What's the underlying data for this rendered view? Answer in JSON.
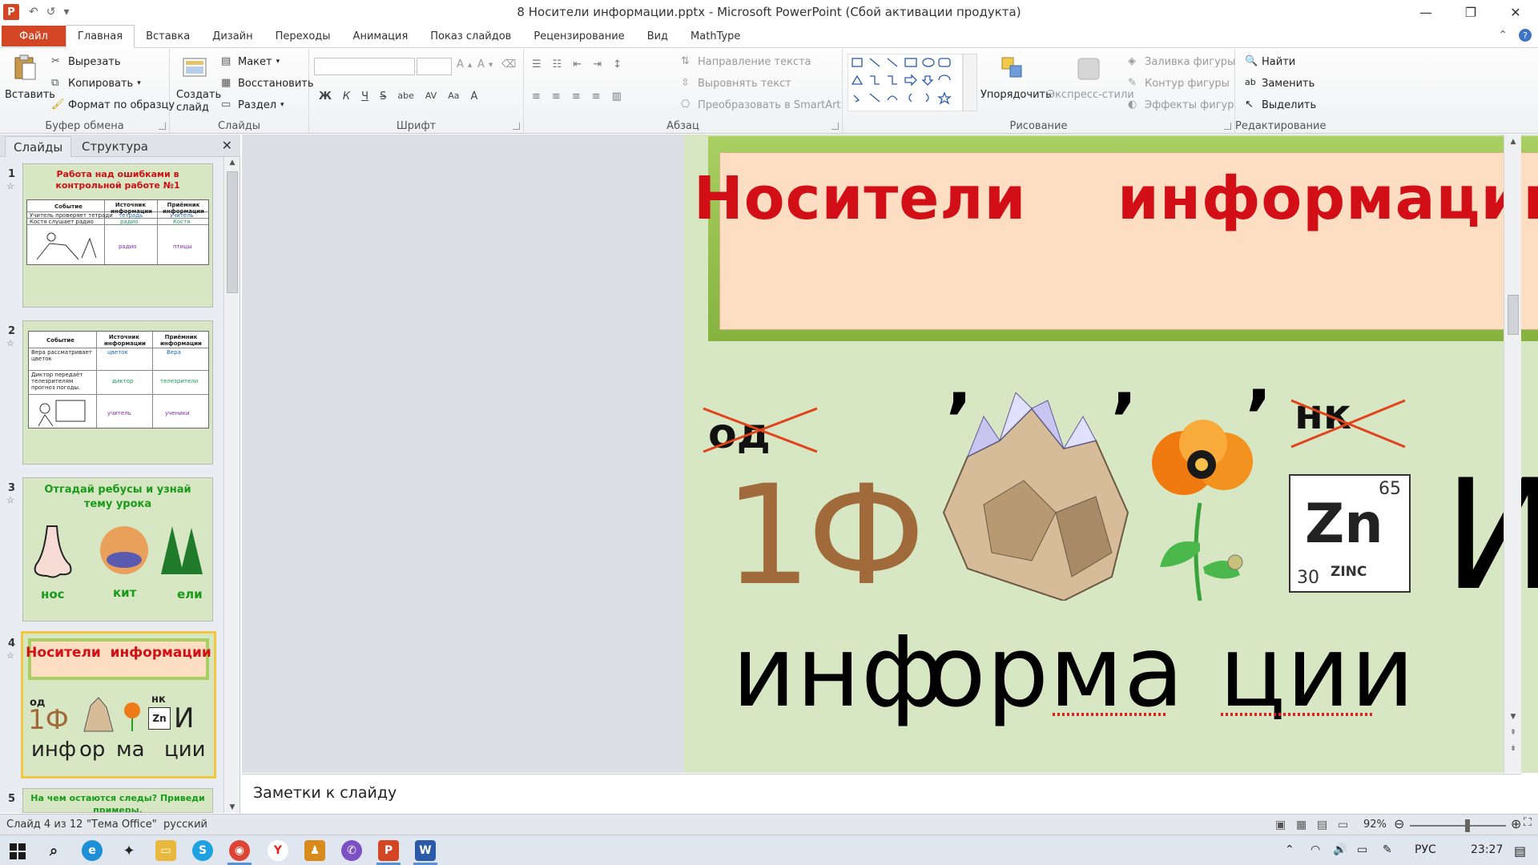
{
  "window": {
    "title": "8 Носители информации.pptx - Microsoft PowerPoint (Сбой активации продукта)",
    "qat_icons": [
      "save-icon",
      "undo-icon",
      "redo-icon",
      "customize-icon"
    ]
  },
  "tabs": [
    "Файл",
    "Главная",
    "Вставка",
    "Дизайн",
    "Переходы",
    "Анимация",
    "Показ слайдов",
    "Рецензирование",
    "Вид",
    "MathType"
  ],
  "active_tab": "Главная",
  "ribbon": {
    "clipboard": {
      "label": "Буфер обмена",
      "paste": "Вставить",
      "cut": "Вырезать",
      "copy": "Копировать",
      "format_painter": "Формат по образцу"
    },
    "slides": {
      "label": "Слайды",
      "new_slide": "Создать слайд",
      "layout": "Макет",
      "reset": "Восстановить",
      "section": "Раздел"
    },
    "font": {
      "label": "Шрифт",
      "name": "",
      "size": "",
      "bold": "Ж",
      "italic": "К",
      "underline": "Ч",
      "strike": "S",
      "shadow": "abe",
      "spacing": "AV",
      "case": "Aa",
      "color": "A"
    },
    "paragraph": {
      "label": "Абзац",
      "text_direction": "Направление текста",
      "align_text": "Выровнять текст",
      "smartart": "Преобразовать в SmartArt"
    },
    "drawing": {
      "label": "Рисование",
      "arrange": "Упорядочить",
      "quick_styles": "Экспресс-стили",
      "shape_fill": "Заливка фигуры",
      "shape_outline": "Контур фигуры",
      "shape_effects": "Эффекты фигур"
    },
    "editing": {
      "label": "Редактирование",
      "find": "Найти",
      "replace": "Заменить",
      "select": "Выделить"
    }
  },
  "left_pane": {
    "tab_slides": "Слайды",
    "tab_outline": "Структура",
    "thumbs": [
      {
        "num": "1",
        "title": "Работа над ошибками  в контрольной работе №1",
        "headers": [
          "Событие",
          "Источник информации",
          "Приёмник информации"
        ],
        "rows": [
          [
            "Учитель проверяет тетради",
            "тетрадь",
            "учитель"
          ],
          [
            "Костя слушает радио",
            "радио",
            "Костя"
          ]
        ],
        "cells": [
          "радио",
          "птицы"
        ]
      },
      {
        "num": "2",
        "headers": [
          "Событие",
          "Источник информации",
          "Приёмник информации"
        ],
        "rows": [
          [
            "Вера рассматривает цветок",
            "цветок",
            "Вера"
          ],
          [
            "Диктор передаёт телезрителям прогноз погоды.",
            "диктор",
            "телезрители"
          ]
        ],
        "cells": [
          "учитель",
          "ученики"
        ]
      },
      {
        "num": "3",
        "title": "Отгадай ребусы и узнай тему урока",
        "words": [
          "нос",
          "кит",
          "ели"
        ]
      },
      {
        "num": "4",
        "title": "Носители  информации",
        "r1": [
          "од",
          "нк",
          "1Ф",
          "И"
        ],
        "r2": [
          "инф",
          "ор",
          "ма",
          "ции"
        ]
      },
      {
        "num": "5",
        "title": "На чем остаются следы? Приведи примеры."
      }
    ]
  },
  "slide": {
    "title": "Носители  информации",
    "crossed_left": "од",
    "crossed_right": "нк",
    "big_left": "1Ф",
    "big_right": "И",
    "comma": "’",
    "zinc": {
      "symbol": "Zn",
      "mass": "65",
      "number": "30",
      "name": "ZINC"
    },
    "words": [
      "инф",
      "ор",
      "ма",
      "ции"
    ]
  },
  "notes_placeholder": "Заметки к слайду",
  "status": {
    "slide_info": "Слайд 4 из 12",
    "theme": "\"Тема Office\"",
    "language": "русский",
    "zoom": "92%",
    "zoom_level": 0.6
  },
  "taskbar": {
    "lang": "РУС",
    "time": "23:27"
  },
  "colors": {
    "accent_red": "#d20f16",
    "file_tab": "#d24625",
    "slide_bg": "#d8e7c3",
    "title_fill": "#fddec3",
    "title_border": "#86b33f"
  }
}
